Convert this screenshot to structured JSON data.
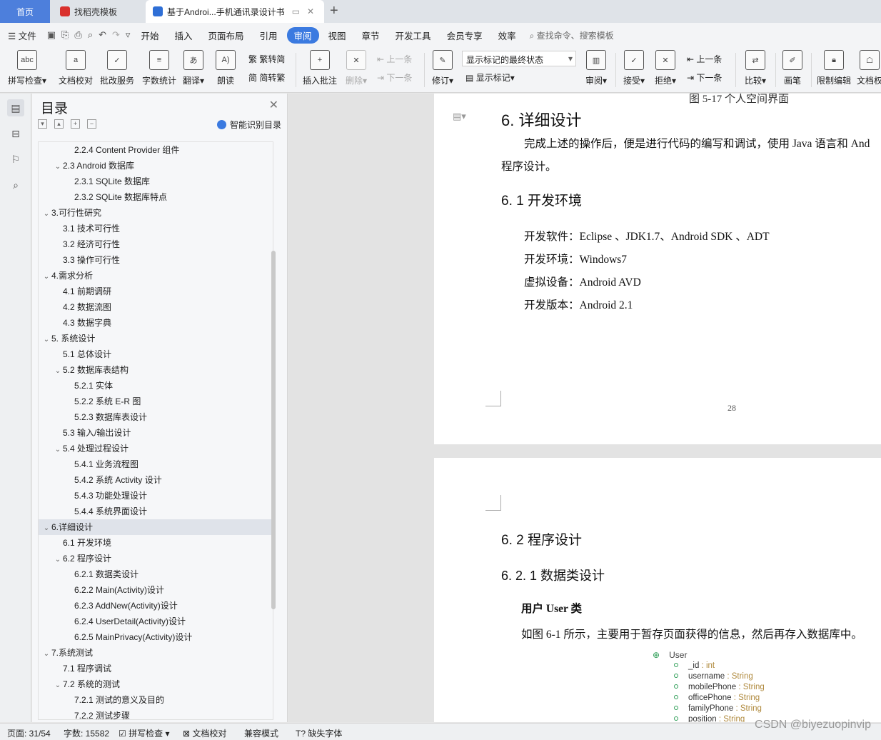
{
  "tabs": {
    "home": "首页",
    "template": "找稻壳模板",
    "doc": "基于Androi...手机通讯录设计书"
  },
  "menu": {
    "file": "文件",
    "items": [
      "开始",
      "插入",
      "页面布局",
      "引用",
      "审阅",
      "视图",
      "章节",
      "开发工具",
      "会员专享",
      "效率"
    ],
    "active": "审阅",
    "search": "查找命令、搜索模板"
  },
  "ribbon": {
    "spell": "拼写检查",
    "proof": "文档校对",
    "batch": "批改服务",
    "count": "字数统计",
    "translate": "翻译",
    "read": "朗读",
    "to_simplified": "繁转简",
    "to_traditional": "简转繁",
    "insert_comment": "插入批注",
    "delete": "删除",
    "prev": "上一条",
    "next": "下一条",
    "revise": "修订",
    "display_state": "显示标记的最终状态",
    "show_marks": "显示标记",
    "review": "审阅",
    "accept": "接受",
    "reject": "拒绝",
    "prev2": "上一条",
    "next2": "下一条",
    "compare": "比较",
    "pen": "画笔",
    "restrict": "限制编辑",
    "doc_permission": "文档权"
  },
  "toc": {
    "title": "目录",
    "smart": "智能识别目录",
    "items": [
      {
        "text": "2.2.4 Content Provider  组件",
        "level": 3,
        "caret": ""
      },
      {
        "text": "2.3 Android 数据库",
        "level": 2,
        "caret": "v"
      },
      {
        "text": "2.3.1 SQLite 数据库",
        "level": 3,
        "caret": ""
      },
      {
        "text": "2.3.2 SQLite 数据库特点",
        "level": 3,
        "caret": ""
      },
      {
        "text": "3.可行性研究",
        "level": 1,
        "caret": "v"
      },
      {
        "text": "3.1  技术可行性",
        "level": 2,
        "caret": ""
      },
      {
        "text": "3.2  经济可行性",
        "level": 2,
        "caret": ""
      },
      {
        "text": "3.3  操作可行性",
        "level": 2,
        "caret": ""
      },
      {
        "text": "4.需求分析",
        "level": 1,
        "caret": "v"
      },
      {
        "text": "4.1  前期调研",
        "level": 2,
        "caret": ""
      },
      {
        "text": "4.2  数据流图",
        "level": 2,
        "caret": ""
      },
      {
        "text": "4.3  数据字典",
        "level": 2,
        "caret": ""
      },
      {
        "text": "5.  系统设计",
        "level": 1,
        "caret": "v"
      },
      {
        "text": "5.1  总体设计",
        "level": 2,
        "caret": ""
      },
      {
        "text": "5.2  数据库表结构",
        "level": 2,
        "caret": "v"
      },
      {
        "text": "5.2.1  实体",
        "level": 3,
        "caret": ""
      },
      {
        "text": "5.2.2  系统 E-R 图",
        "level": 3,
        "caret": ""
      },
      {
        "text": "5.2.3  数据库表设计",
        "level": 3,
        "caret": ""
      },
      {
        "text": "5.3  输入/输出设计",
        "level": 2,
        "caret": ""
      },
      {
        "text": "5.4  处理过程设计",
        "level": 2,
        "caret": "v"
      },
      {
        "text": "5.4.1  业务流程图",
        "level": 3,
        "caret": ""
      },
      {
        "text": "5.4.2  系统 Activity 设计",
        "level": 3,
        "caret": ""
      },
      {
        "text": "5.4.3  功能处理设计",
        "level": 3,
        "caret": ""
      },
      {
        "text": "5.4.4  系统界面设计",
        "level": 3,
        "caret": ""
      },
      {
        "text": "6.详细设计",
        "level": 1,
        "caret": "v",
        "selected": true
      },
      {
        "text": "6.1  开发环境",
        "level": 2,
        "caret": ""
      },
      {
        "text": "6.2  程序设计",
        "level": 2,
        "caret": "v"
      },
      {
        "text": "6.2.1  数据类设计",
        "level": 3,
        "caret": ""
      },
      {
        "text": "6.2.2 Main(Activity)设计",
        "level": 3,
        "caret": ""
      },
      {
        "text": "6.2.3 AddNew(Activity)设计",
        "level": 3,
        "caret": ""
      },
      {
        "text": "6.2.4 UserDetail(Activity)设计",
        "level": 3,
        "caret": ""
      },
      {
        "text": "6.2.5 MainPrivacy(Activity)设计",
        "level": 3,
        "caret": ""
      },
      {
        "text": "7.系统测试",
        "level": 1,
        "caret": "v"
      },
      {
        "text": "7.1  程序调试",
        "level": 2,
        "caret": ""
      },
      {
        "text": "7.2  系统的测试",
        "level": 2,
        "caret": "v"
      },
      {
        "text": "7.2.1  测试的意义及目的",
        "level": 3,
        "caret": ""
      },
      {
        "text": "7.2.2  测试步骤",
        "level": 3,
        "caret": ""
      }
    ]
  },
  "page1": {
    "fig_caption": "图 5-17  个人空间界面",
    "h1": "6. 详细设计",
    "para1": "完成上述的操作后，便是进行代码的编写和调试，使用 Java 语言和 And",
    "para1b": "程序设计。",
    "h2": "6. 1  开发环境",
    "env1": "开发软件：Eclipse  、JDK1.7、Android SDK  、ADT",
    "env2": "开发环境：Windows7",
    "env3": "虚拟设备：Android AVD",
    "env4": "开发版本：Android 2.1",
    "page_num": "28"
  },
  "page2": {
    "h2": "6. 2  程序设计",
    "h3": "6. 2. 1  数据类设计",
    "bold": "用户 User 类",
    "para": "如图 6-1 所示，主要用于暂存页面获得的信息，然后再存入数据库中。",
    "uml_class": "User",
    "uml_fields": [
      {
        "name": "_id",
        "type": "int"
      },
      {
        "name": "username",
        "type": "String"
      },
      {
        "name": "mobilePhone",
        "type": "String"
      },
      {
        "name": "officePhone",
        "type": "String"
      },
      {
        "name": "familyPhone",
        "type": "String"
      },
      {
        "name": "position",
        "type": "String"
      }
    ]
  },
  "status": {
    "page": "页面: 31/54",
    "words": "字数: 15582",
    "spell": "拼写检查",
    "proof": "文档校对",
    "compat": "兼容模式",
    "missing_font": "缺失字体"
  },
  "watermark": "CSDN @biyezuopinvip"
}
